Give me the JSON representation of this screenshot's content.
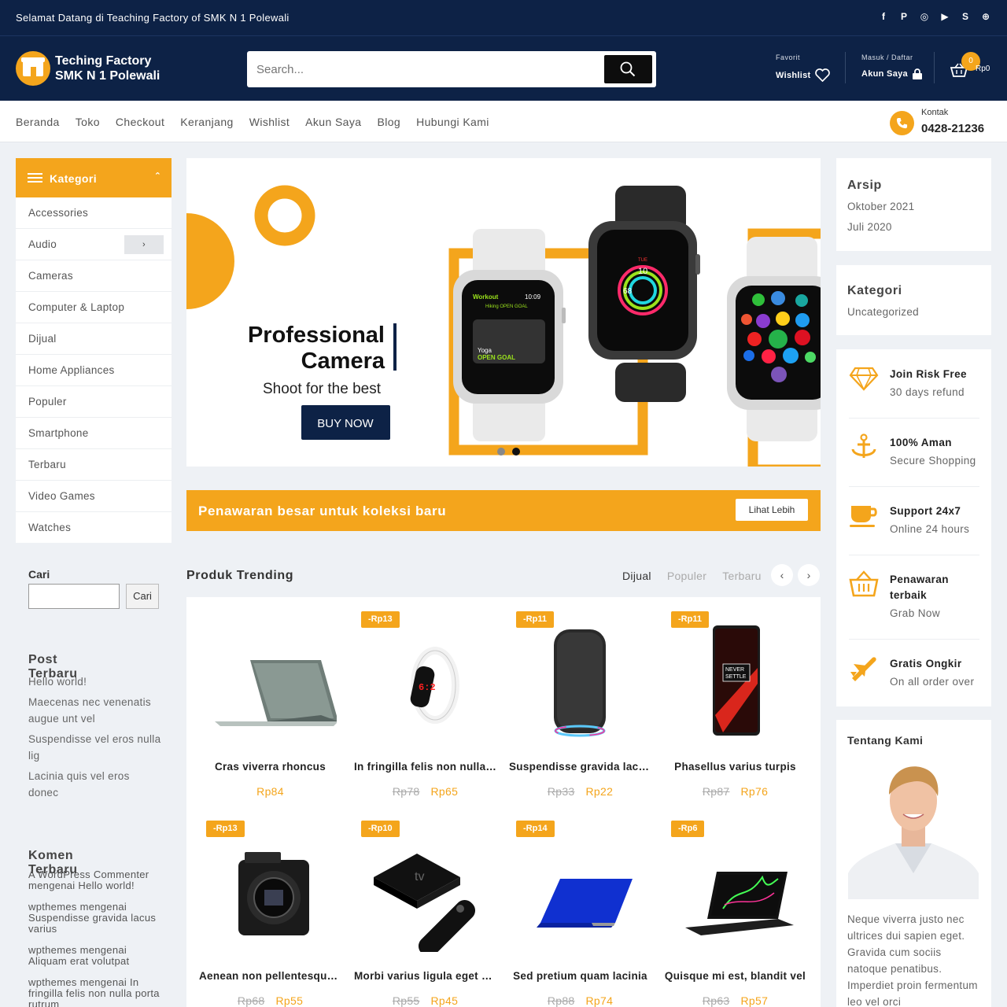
{
  "topbar": {
    "welcome": "Selamat Datang di Teaching Factory of SMK N 1 Polewali",
    "social": [
      "f",
      "P",
      "◎",
      "▶",
      "S",
      "⊕"
    ]
  },
  "header": {
    "logo_line1": "Teching Factory",
    "logo_line2": "SMK N 1 Polewali",
    "search_placeholder": "Search...",
    "favorit_label": "Favorit",
    "wishlist_label": "Wishlist",
    "account_small": "Masuk / Daftar",
    "account_label": "Akun Saya",
    "cart_count": "0",
    "cart_total": "Rp0"
  },
  "nav": {
    "items": [
      "Beranda",
      "Toko",
      "Checkout",
      "Keranjang",
      "Wishlist",
      "Akun Saya",
      "Blog",
      "Hubungi Kami"
    ],
    "contact_label": "Kontak",
    "contact_phone": "0428-21236"
  },
  "categories": {
    "title": "Kategori",
    "items": [
      "Accessories",
      "Audio",
      "Cameras",
      "Computer & Laptop",
      "Dijual",
      "Home Appliances",
      "Populer",
      "Smartphone",
      "Terbaru",
      "Video Games",
      "Watches"
    ]
  },
  "search_widget": {
    "label": "Cari",
    "button": "Cari"
  },
  "recent_posts": {
    "title": "Post Terbaru",
    "items": [
      "Hello world!",
      "Maecenas nec venenatis augue unt vel",
      "Suspendisse vel eros nulla lig",
      "Lacinia quis vel eros donec"
    ]
  },
  "recent_comments": {
    "title": "Komen Terbaru",
    "items": [
      {
        "author": "A WordPress Commenter",
        "on": "mengenai",
        "post": "Hello world!"
      },
      {
        "author": "wpthemes",
        "on": "mengenai",
        "post": "Suspendisse gravida lacus varius"
      },
      {
        "author": "wpthemes",
        "on": "mengenai",
        "post": "Aliquam erat volutpat"
      },
      {
        "author": "wpthemes",
        "on": "mengenai",
        "post": "In fringilla felis non nulla porta rutrum"
      }
    ]
  },
  "slider": {
    "title_line1": "Professional",
    "title_line2": "Camera",
    "subtitle": "Shoot for the best",
    "button": "BUY NOW",
    "watch1_app": "Workout",
    "watch1_time": "10:09",
    "watch1_goal": "Hiking OPEN GOAL",
    "watch1_activity": "Yoga",
    "watch1_status": "OPEN GOAL",
    "watch2_day": "TUE",
    "watch2_date": "10",
    "watch2_temp": "68"
  },
  "promo": {
    "text": "Penawaran besar untuk koleksi baru",
    "button": "Lihat Lebih"
  },
  "trending": {
    "title": "Produk Trending",
    "tabs": [
      "Dijual",
      "Populer",
      "Terbaru"
    ],
    "products": [
      {
        "name": "Cras viverra rhoncus",
        "discount": "",
        "old": "",
        "price": "Rp84",
        "icon": "laptop-image"
      },
      {
        "name": "In fringilla felis non nulla porta",
        "discount": "-Rp13",
        "old": "Rp78",
        "price": "Rp65",
        "icon": "led-watch-image"
      },
      {
        "name": "Suspendisse gravida lacus varius",
        "discount": "-Rp11",
        "old": "Rp33",
        "price": "Rp22",
        "icon": "speaker-image"
      },
      {
        "name": "Phasellus varius turpis",
        "discount": "-Rp11",
        "old": "Rp87",
        "price": "Rp76",
        "icon": "smartphone-image"
      },
      {
        "name": "Aenean non pellentesque ligula",
        "discount": "-Rp13",
        "old": "Rp68",
        "price": "Rp55",
        "icon": "camera-image"
      },
      {
        "name": "Morbi varius ligula eget nunc",
        "discount": "-Rp10",
        "old": "Rp55",
        "price": "Rp45",
        "icon": "apple-tv-image"
      },
      {
        "name": "Sed pretium quam lacinia",
        "discount": "-Rp14",
        "old": "Rp88",
        "price": "Rp74",
        "icon": "blue-laptop-image"
      },
      {
        "name": "Quisque mi est, blandit vel",
        "discount": "-Rp6",
        "old": "Rp63",
        "price": "Rp57",
        "icon": "gaming-laptop-image"
      }
    ]
  },
  "archive": {
    "title": "Arsip",
    "items": [
      "Oktober 2021",
      "Juli 2020"
    ]
  },
  "categories_widget": {
    "title": "Kategori",
    "items": [
      "Uncategorized"
    ]
  },
  "features": [
    {
      "title": "Join Risk Free",
      "sub": "30 days refund",
      "icon": "diamond-icon"
    },
    {
      "title": "100% Aman",
      "sub": "Secure Shopping",
      "icon": "anchor-icon"
    },
    {
      "title": "Support 24x7",
      "sub": "Online 24 hours",
      "icon": "cup-icon"
    },
    {
      "title": "Penawaran terbaik",
      "sub": "Grab Now",
      "icon": "basket-icon"
    },
    {
      "title": "Gratis Ongkir",
      "sub": "On all order over",
      "icon": "plane-icon"
    }
  ],
  "about": {
    "title": "Tentang Kami",
    "text": "Neque viverra justo nec ultrices dui sapien eget. Gravida cum sociis natoque penatibus. Imperdiet proin fermentum leo vel orci"
  },
  "colors": {
    "navy": "#0d2246",
    "accent": "#f4a51c"
  }
}
